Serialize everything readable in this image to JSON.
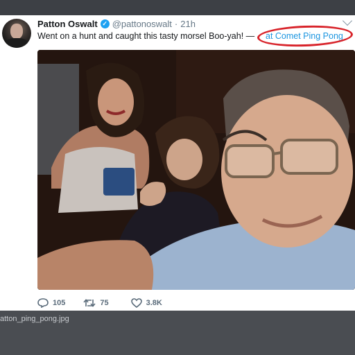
{
  "tweet": {
    "display_name": "Patton Oswalt",
    "handle": "@pattonoswalt",
    "separator": "·",
    "timestamp": "21h",
    "text": "Went on a hunt and caught this tasty morsel  Boo-yah! —",
    "location": "at Comet Ping Pong",
    "verified_icon": "verified-badge-icon",
    "menu_icon": "chevron-down-icon"
  },
  "actions": {
    "reply_count": "105",
    "retweet_count": "75",
    "like_count": "3.8K"
  },
  "annotation": {
    "highlight_color": "#d8232a"
  },
  "attachment": {
    "filename": "atton_ping_pong.jpg"
  },
  "colors": {
    "link": "#1b95e0",
    "verified": "#1da1f2",
    "page_background": "#4a4d52"
  }
}
